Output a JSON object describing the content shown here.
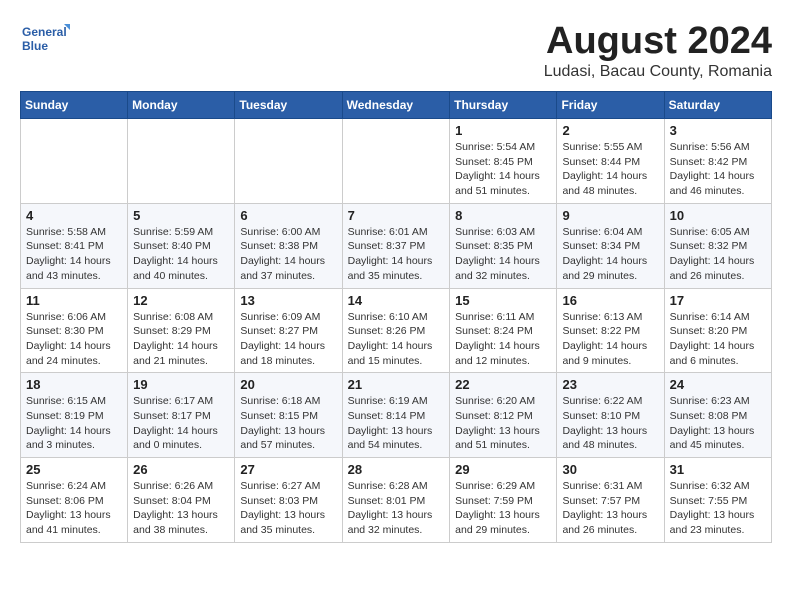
{
  "logo": {
    "line1": "General",
    "line2": "Blue"
  },
  "title": "August 2024",
  "subtitle": "Ludasi, Bacau County, Romania",
  "weekdays": [
    "Sunday",
    "Monday",
    "Tuesday",
    "Wednesday",
    "Thursday",
    "Friday",
    "Saturday"
  ],
  "weeks": [
    [
      {
        "day": "",
        "info": ""
      },
      {
        "day": "",
        "info": ""
      },
      {
        "day": "",
        "info": ""
      },
      {
        "day": "",
        "info": ""
      },
      {
        "day": "1",
        "info": "Sunrise: 5:54 AM\nSunset: 8:45 PM\nDaylight: 14 hours\nand 51 minutes."
      },
      {
        "day": "2",
        "info": "Sunrise: 5:55 AM\nSunset: 8:44 PM\nDaylight: 14 hours\nand 48 minutes."
      },
      {
        "day": "3",
        "info": "Sunrise: 5:56 AM\nSunset: 8:42 PM\nDaylight: 14 hours\nand 46 minutes."
      }
    ],
    [
      {
        "day": "4",
        "info": "Sunrise: 5:58 AM\nSunset: 8:41 PM\nDaylight: 14 hours\nand 43 minutes."
      },
      {
        "day": "5",
        "info": "Sunrise: 5:59 AM\nSunset: 8:40 PM\nDaylight: 14 hours\nand 40 minutes."
      },
      {
        "day": "6",
        "info": "Sunrise: 6:00 AM\nSunset: 8:38 PM\nDaylight: 14 hours\nand 37 minutes."
      },
      {
        "day": "7",
        "info": "Sunrise: 6:01 AM\nSunset: 8:37 PM\nDaylight: 14 hours\nand 35 minutes."
      },
      {
        "day": "8",
        "info": "Sunrise: 6:03 AM\nSunset: 8:35 PM\nDaylight: 14 hours\nand 32 minutes."
      },
      {
        "day": "9",
        "info": "Sunrise: 6:04 AM\nSunset: 8:34 PM\nDaylight: 14 hours\nand 29 minutes."
      },
      {
        "day": "10",
        "info": "Sunrise: 6:05 AM\nSunset: 8:32 PM\nDaylight: 14 hours\nand 26 minutes."
      }
    ],
    [
      {
        "day": "11",
        "info": "Sunrise: 6:06 AM\nSunset: 8:30 PM\nDaylight: 14 hours\nand 24 minutes."
      },
      {
        "day": "12",
        "info": "Sunrise: 6:08 AM\nSunset: 8:29 PM\nDaylight: 14 hours\nand 21 minutes."
      },
      {
        "day": "13",
        "info": "Sunrise: 6:09 AM\nSunset: 8:27 PM\nDaylight: 14 hours\nand 18 minutes."
      },
      {
        "day": "14",
        "info": "Sunrise: 6:10 AM\nSunset: 8:26 PM\nDaylight: 14 hours\nand 15 minutes."
      },
      {
        "day": "15",
        "info": "Sunrise: 6:11 AM\nSunset: 8:24 PM\nDaylight: 14 hours\nand 12 minutes."
      },
      {
        "day": "16",
        "info": "Sunrise: 6:13 AM\nSunset: 8:22 PM\nDaylight: 14 hours\nand 9 minutes."
      },
      {
        "day": "17",
        "info": "Sunrise: 6:14 AM\nSunset: 8:20 PM\nDaylight: 14 hours\nand 6 minutes."
      }
    ],
    [
      {
        "day": "18",
        "info": "Sunrise: 6:15 AM\nSunset: 8:19 PM\nDaylight: 14 hours\nand 3 minutes."
      },
      {
        "day": "19",
        "info": "Sunrise: 6:17 AM\nSunset: 8:17 PM\nDaylight: 14 hours\nand 0 minutes."
      },
      {
        "day": "20",
        "info": "Sunrise: 6:18 AM\nSunset: 8:15 PM\nDaylight: 13 hours\nand 57 minutes."
      },
      {
        "day": "21",
        "info": "Sunrise: 6:19 AM\nSunset: 8:14 PM\nDaylight: 13 hours\nand 54 minutes."
      },
      {
        "day": "22",
        "info": "Sunrise: 6:20 AM\nSunset: 8:12 PM\nDaylight: 13 hours\nand 51 minutes."
      },
      {
        "day": "23",
        "info": "Sunrise: 6:22 AM\nSunset: 8:10 PM\nDaylight: 13 hours\nand 48 minutes."
      },
      {
        "day": "24",
        "info": "Sunrise: 6:23 AM\nSunset: 8:08 PM\nDaylight: 13 hours\nand 45 minutes."
      }
    ],
    [
      {
        "day": "25",
        "info": "Sunrise: 6:24 AM\nSunset: 8:06 PM\nDaylight: 13 hours\nand 41 minutes."
      },
      {
        "day": "26",
        "info": "Sunrise: 6:26 AM\nSunset: 8:04 PM\nDaylight: 13 hours\nand 38 minutes."
      },
      {
        "day": "27",
        "info": "Sunrise: 6:27 AM\nSunset: 8:03 PM\nDaylight: 13 hours\nand 35 minutes."
      },
      {
        "day": "28",
        "info": "Sunrise: 6:28 AM\nSunset: 8:01 PM\nDaylight: 13 hours\nand 32 minutes."
      },
      {
        "day": "29",
        "info": "Sunrise: 6:29 AM\nSunset: 7:59 PM\nDaylight: 13 hours\nand 29 minutes."
      },
      {
        "day": "30",
        "info": "Sunrise: 6:31 AM\nSunset: 7:57 PM\nDaylight: 13 hours\nand 26 minutes."
      },
      {
        "day": "31",
        "info": "Sunrise: 6:32 AM\nSunset: 7:55 PM\nDaylight: 13 hours\nand 23 minutes."
      }
    ]
  ]
}
